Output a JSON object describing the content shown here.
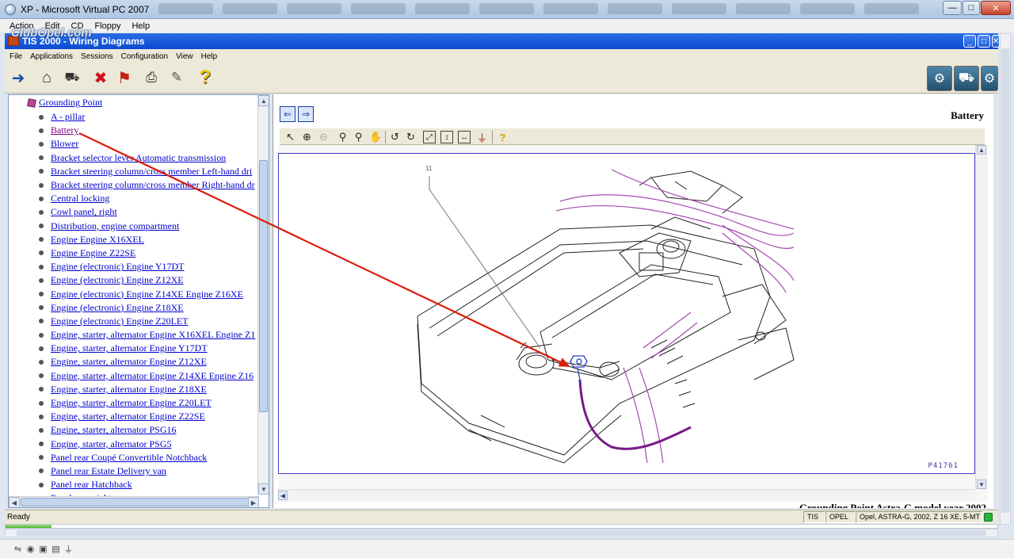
{
  "host": {
    "title": "XP - Microsoft Virtual PC 2007",
    "menu": [
      "Action",
      "Edit",
      "CD",
      "Floppy",
      "Help"
    ],
    "watermark": "ClubOpel.com"
  },
  "app": {
    "title": "TIS 2000 - Wiring Diagrams",
    "menu": [
      "File",
      "Applications",
      "Sessions",
      "Configuration",
      "View",
      "Help"
    ]
  },
  "toolbar": {
    "icons": [
      "exit-icon",
      "home-icon",
      "vehicle-selection-icon",
      "cancel-icon",
      "person-icon",
      "print-icon",
      "notes-icon",
      "help-icon"
    ],
    "right_icons": [
      "diagnostics-icon",
      "vehicle-icon",
      "vehicle-programming-icon"
    ]
  },
  "tree": {
    "header": "Grounding Point",
    "items": [
      "A - pillar",
      "Battery",
      "Blower",
      "Bracket selector lever Automatic transmission",
      "Bracket steering column/cross member Left-hand dri",
      "Bracket steering column/cross member Right-hand dr",
      "Central locking",
      "Cowl panel, right",
      "Distribution, engine compartment",
      "Engine Engine X16XEL",
      "Engine Engine Z22SE",
      "Engine (electronic) Engine Y17DT",
      "Engine (electronic) Engine Z12XE",
      "Engine (electronic) Engine Z14XE Engine Z16XE",
      "Engine (electronic) Engine Z18XE",
      "Engine (electronic) Engine Z20LET",
      "Engine, starter, alternator Engine X16XEL Engine Z1",
      "Engine, starter, alternator Engine Y17DT",
      "Engine, starter, alternator Engine Z12XE",
      "Engine, starter, alternator Engine Z14XE Engine Z16",
      "Engine, starter, alternator Engine Z18XE",
      "Engine, starter, alternator Engine Z20LET",
      "Engine, starter, alternator Engine Z22SE",
      "Engine, starter, alternator PSG16",
      "Engine, starter, alternator PSG5",
      "Panel rear Coupé Convertible Notchback",
      "Panel rear Estate Delivery van",
      "Panel rear Hatchback",
      "Panel rear, right"
    ],
    "visited_index": 1
  },
  "diagram": {
    "title": "Battery",
    "callout": "11",
    "code": "P41761",
    "caption": "Grounding Point Astra-G model year 2002",
    "tools": [
      "select-icon",
      "zoom-in-icon",
      "zoom-out-icon",
      "find-icon",
      "zoom-area-icon",
      "pan-icon",
      "rotate-left-icon",
      "rotate-right-icon",
      "fit-window-icon",
      "fit-height-icon",
      "fit-width-icon",
      "grounding-icon",
      "help-icon"
    ]
  },
  "status": {
    "text": "Ready",
    "cells": [
      "TIS",
      "OPEL",
      "Opel, ASTRA-G, 2002, Z 16 XE, 5-MT"
    ]
  },
  "host_status": {
    "progress": 0.046
  },
  "colors": {
    "title_blue": "#0b4ad1",
    "link": "#0000cc",
    "visited_link": "#800080",
    "annotation_arrow": "#dd1c0c",
    "ground_wire": "#7a1a8a",
    "harness": "#a64cb0"
  }
}
